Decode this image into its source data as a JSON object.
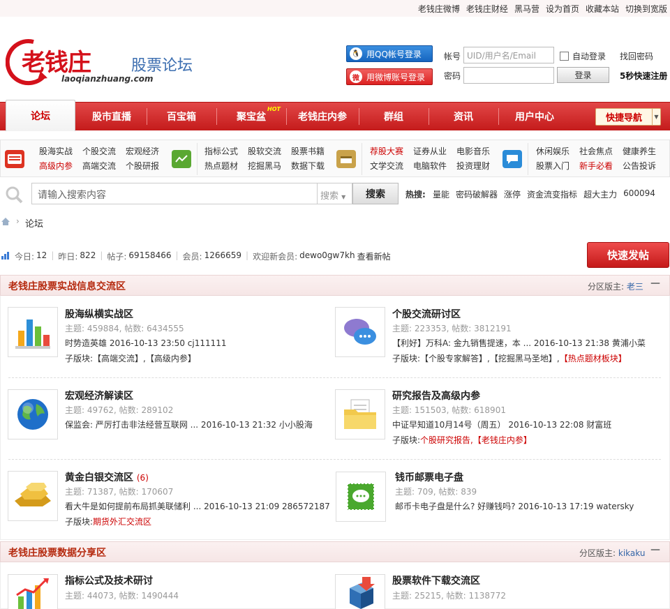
{
  "top_links": [
    "老钱庄微博",
    "老钱庄财经",
    "黑马营",
    "设为首页",
    "收藏本站",
    "切换到宽版"
  ],
  "logo": {
    "text": "老钱庄",
    "domain": "laoqianzhuang.com"
  },
  "site_title": "股票论坛",
  "login": {
    "qq_label": "用QQ帐号登录",
    "weibo_label": "用微博账号登录",
    "account_label": "帐号",
    "account_placeholder": "UID/用户名/Email",
    "password_label": "密码",
    "auto_login": "自动登录",
    "find_password": "找回密码",
    "login_button": "登录",
    "quick_register": "5秒快速注册"
  },
  "nav": {
    "items": [
      "论坛",
      "股市直播",
      "百宝箱",
      "聚宝盆",
      "老钱庄内参",
      "群组",
      "资讯",
      "用户中心"
    ],
    "hot_badge": "HOT",
    "quick_nav": "快捷导航"
  },
  "subnav": {
    "group1": [
      "股海实战",
      "个股交流",
      "宏观经济",
      "高级内参",
      "高端交流",
      "个股研报"
    ],
    "group2": [
      "指标公式",
      "股软交流",
      "股票书籍",
      "热点题材",
      "挖掘黑马",
      "数据下载"
    ],
    "group3": [
      "荐股大赛",
      "证券从业",
      "电影音乐",
      "文学交流",
      "电脑软件",
      "投资理财"
    ],
    "group4": [
      "休闲娱乐",
      "社会焦点",
      "健康养生",
      "股票入门",
      "新手必看",
      "公告投诉"
    ]
  },
  "search": {
    "placeholder": "请输入搜索内容",
    "type": "搜索",
    "button": "搜索",
    "hot_label": "热搜:",
    "hot_words": [
      "量能",
      "密码破解器",
      "涨停",
      "资金流变指标",
      "超大主力",
      "600094"
    ]
  },
  "breadcrumb": "论坛",
  "stats": {
    "today_label": "今日:",
    "today": "12",
    "yesterday_label": "昨日:",
    "yesterday": "822",
    "posts_label": "帖子:",
    "posts": "69158466",
    "members_label": "会员:",
    "members": "1266659",
    "welcome_label": "欢迎新会员:",
    "new_member": "dewo0gw7kh",
    "view_new": "查看新帖"
  },
  "post_button": "快速发帖",
  "sections": [
    {
      "title": "老钱庄股票实战信息交流区",
      "moderator_label": "分区版主:",
      "moderator": "老三",
      "collapse": "—",
      "forums": [
        {
          "icon": "bar-chart-icon",
          "name": "股海纵横实战区",
          "count": "",
          "meta": "主题: 459884, 帖数: 6434555",
          "last": "时势造英雄  2016-10-13 23:50 cj111111",
          "sub_label": "子版块:",
          "sub": "【高端交流】,【高级内参】",
          "sub_red": ""
        },
        {
          "icon": "chat-bubbles-icon",
          "name": "个股交流研讨区",
          "count": "",
          "meta": "主题: 223353, 帖数: 3812191",
          "last": "【利好】万科A: 金九销售提速，本 ... 2016-10-13 21:38 黄浦小菜",
          "sub_label": "子版块:",
          "sub": "【个股专家解答】,【挖掘黑马圣地】,",
          "sub_red": "【热点题材板块】"
        },
        {
          "icon": "globe-icon",
          "name": "宏观经济解读区",
          "count": "",
          "meta": "主题: 49762, 帖数: 289102",
          "last": "保监会: 严厉打击非法经营互联网 ... 2016-10-13 21:32 小小股海",
          "sub_label": "",
          "sub": "",
          "sub_red": ""
        },
        {
          "icon": "folder-icon",
          "name": "研究报告及高级内参",
          "count": "",
          "meta": "主题: 151503, 帖数: 618901",
          "last": "中证早知道10月14号（周五）  2016-10-13 22:08 财富班",
          "sub_label": "子版块:",
          "sub": "",
          "sub_red": "个股研究报告,【老钱庄内参】"
        },
        {
          "icon": "gold-bars-icon",
          "name": "黄金白银交流区",
          "count": "(6)",
          "meta": "主题: 71387, 帖数: 170607",
          "last": "看大牛是如何提前布局抓美联储利 ... 2016-10-13 21:09 286572187",
          "sub_label": "子版块:",
          "sub": "",
          "sub_red": "期货外汇交流区"
        },
        {
          "icon": "stamp-icon",
          "name": "钱币邮票电子盘",
          "count": "",
          "meta": "主题: 709, 帖数: 839",
          "last": "邮币卡电子盘是什么? 好赚钱吗?  2016-10-13 17:19 watersky",
          "sub_label": "",
          "sub": "",
          "sub_red": ""
        }
      ]
    },
    {
      "title": "老钱庄股票数据分享区",
      "moderator_label": "分区版主:",
      "moderator": "kikaku",
      "collapse": "—",
      "forums": [
        {
          "icon": "rising-chart-icon",
          "name": "指标公式及技术研讨",
          "count": "",
          "meta": "主题: 44073, 帖数: 1490444",
          "last": "",
          "sub_label": "",
          "sub": "",
          "sub_red": ""
        },
        {
          "icon": "software-box-icon",
          "name": "股票软件下载交流区",
          "count": "",
          "meta": "主题: 25215, 帖数: 1138772",
          "last": "",
          "sub_label": "",
          "sub": "",
          "sub_red": ""
        }
      ]
    }
  ],
  "colors": {
    "brand_red": "#d4111b",
    "nav_red": "#c41b1b",
    "link_blue": "#3566a8",
    "section_title": "#b52a0f"
  }
}
